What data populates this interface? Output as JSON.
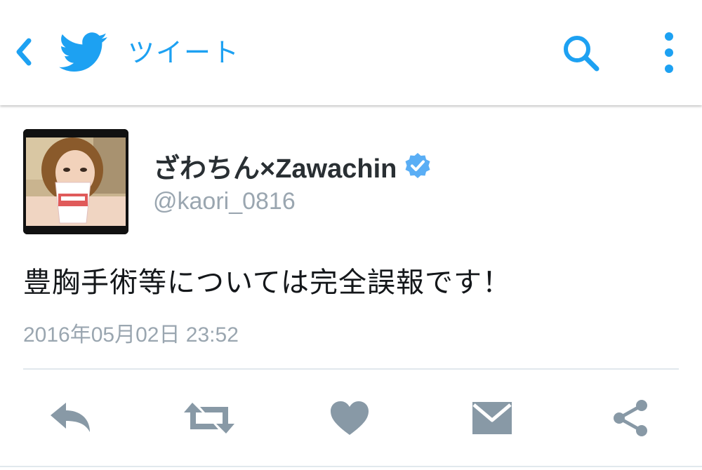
{
  "topbar": {
    "title": "ツイート",
    "icons": [
      "back-chevron-icon",
      "twitter-bird-icon",
      "search-icon",
      "overflow-menu-icon"
    ]
  },
  "tweet": {
    "display_name": "ざわちん×Zawachin",
    "verified": true,
    "handle": "@kaori_0816",
    "text": "豊胸手術等については完全誤報です！",
    "timestamp": "2016年05月02日 23:52",
    "avatar_icon": "user-avatar-photo"
  },
  "actions": [
    "reply-icon",
    "retweet-icon",
    "like-heart-icon",
    "direct-message-icon",
    "share-icon"
  ],
  "colors": {
    "brand_blue": "#1da1f2",
    "icon_gray": "#8899a6",
    "text_primary": "#14171a",
    "text_secondary": "#9aa6b0",
    "verified_blue": "#5aaef5",
    "divider": "#e1e8ed"
  }
}
